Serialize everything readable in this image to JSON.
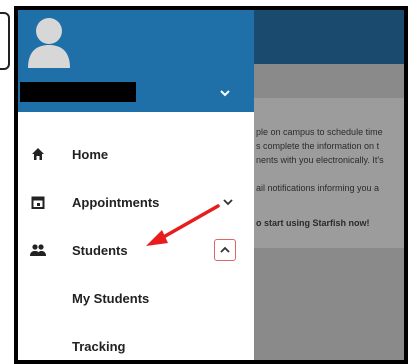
{
  "background_page": {
    "lines": [
      "ple on campus to schedule time",
      "s complete the information on t",
      "nents with you electronically. It's",
      "ail notifications informing you a",
      "o start using Starfish now!"
    ]
  },
  "drawer": {
    "nav": {
      "home": {
        "label": "Home",
        "icon": "home-icon"
      },
      "appointments": {
        "label": "Appointments",
        "icon": "calendar-icon"
      },
      "students": {
        "label": "Students",
        "icon": "people-icon"
      },
      "my_students": {
        "label": "My Students"
      },
      "tracking": {
        "label": "Tracking"
      }
    }
  },
  "colors": {
    "header_blue": "#1f6fa8",
    "annotation_red": "#e81c1c",
    "chevron_box_border": "#e06666"
  }
}
